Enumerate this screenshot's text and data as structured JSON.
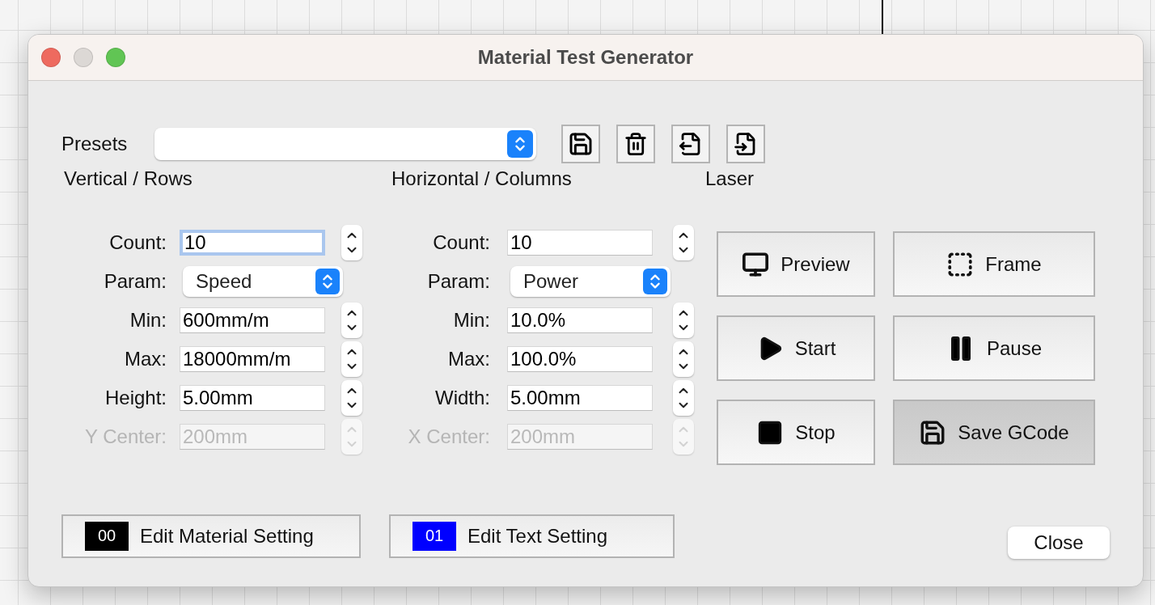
{
  "window": {
    "title": "Material Test Generator"
  },
  "presets": {
    "label": "Presets"
  },
  "sections": [
    {
      "title": "Vertical / Rows",
      "fields": [
        {
          "kind": "spin",
          "label": "Count:",
          "value": "10",
          "focused": true,
          "disabled": false
        },
        {
          "kind": "select",
          "label": "Param:",
          "value": "Speed",
          "disabled": false
        },
        {
          "kind": "spin",
          "label": "Min:",
          "value": "600mm/m",
          "focused": false,
          "disabled": false
        },
        {
          "kind": "spin",
          "label": "Max:",
          "value": "18000mm/m",
          "focused": false,
          "disabled": false
        },
        {
          "kind": "spin",
          "label": "Height:",
          "value": "5.00mm",
          "focused": false,
          "disabled": false
        },
        {
          "kind": "spin",
          "label": "Y Center:",
          "value": "200mm",
          "focused": false,
          "disabled": true
        }
      ]
    },
    {
      "title": "Horizontal / Columns",
      "fields": [
        {
          "kind": "spin",
          "label": "Count:",
          "value": "10",
          "focused": false,
          "disabled": false
        },
        {
          "kind": "select",
          "label": "Param:",
          "value": "Power",
          "disabled": false
        },
        {
          "kind": "spin",
          "label": "Min:",
          "value": "10.0%",
          "focused": false,
          "disabled": false
        },
        {
          "kind": "spin",
          "label": "Max:",
          "value": "100.0%",
          "focused": false,
          "disabled": false
        },
        {
          "kind": "spin",
          "label": "Width:",
          "value": "5.00mm",
          "focused": false,
          "disabled": false
        },
        {
          "kind": "spin",
          "label": "X Center:",
          "value": "200mm",
          "focused": false,
          "disabled": true
        }
      ]
    }
  ],
  "laser": {
    "title": "Laser",
    "buttons": [
      {
        "label": "Preview",
        "highlighted": false
      },
      {
        "label": "Frame",
        "highlighted": false
      },
      {
        "label": "Start",
        "highlighted": false
      },
      {
        "label": "Pause",
        "highlighted": false
      },
      {
        "label": "Stop",
        "highlighted": false
      },
      {
        "label": "Save GCode",
        "highlighted": true
      }
    ]
  },
  "edit_buttons": [
    {
      "code": "00",
      "color": "#000000",
      "label": "Edit Material Setting"
    },
    {
      "code": "01",
      "color": "#0000ff",
      "label": "Edit Text Setting"
    }
  ],
  "close_button": {
    "label": "Close"
  }
}
